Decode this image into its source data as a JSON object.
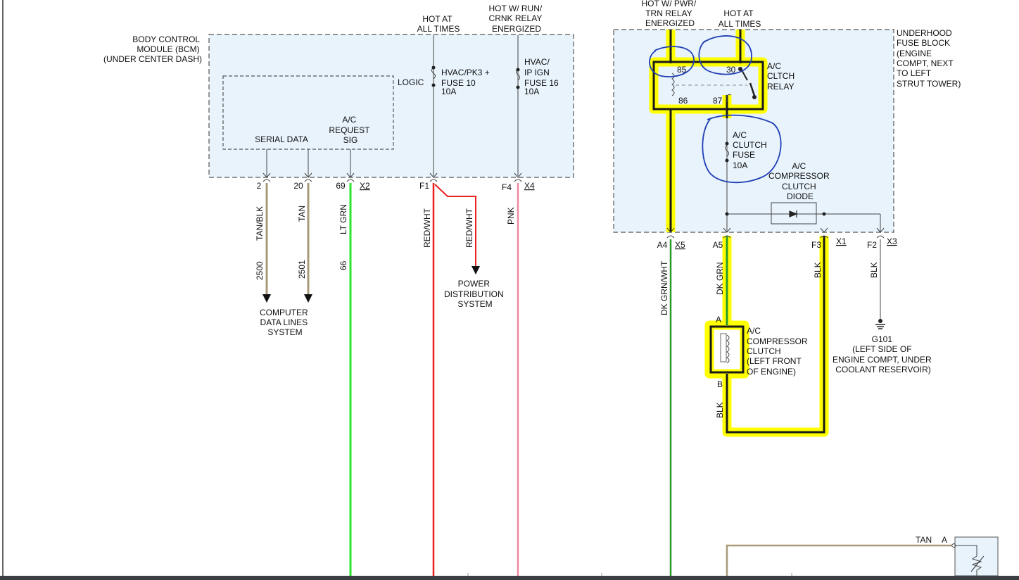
{
  "labels": {
    "bcm_title": [
      "BODY CONTROL",
      "MODULE (BCM)",
      "(UNDER CENTER DASH)"
    ],
    "logic": "LOGIC",
    "serial_data": "SERIAL DATA",
    "ac_request": [
      "A/C",
      "REQUEST",
      "SIG"
    ],
    "hot_all_times_1": [
      "HOT AT",
      "ALL TIMES"
    ],
    "hot_run_crnk": [
      "HOT W/ RUN/",
      "CRNK RELAY",
      "ENERGIZED"
    ],
    "fuse10": [
      "HVAC/PK3 +",
      "FUSE 10",
      "10A"
    ],
    "fuse16": [
      "HVAC/",
      "IP IGN",
      "FUSE 16",
      "10A"
    ],
    "hot_pwr_trn": [
      "HOT W/ PWR/",
      "TRN RELAY",
      "ENERGIZED"
    ],
    "hot_all_times_2": [
      "HOT AT",
      "ALL TIMES"
    ],
    "underhood": [
      "UNDERHOOD",
      "FUSE BLOCK",
      "(ENGINE",
      "COMPT, NEXT",
      "TO LEFT",
      "STRUT TOWER)"
    ],
    "relay": [
      "A/C",
      "CLTCH",
      "RELAY"
    ],
    "clutch_fuse": [
      "A/C",
      "CLUTCH",
      "FUSE",
      "10A"
    ],
    "diode": [
      "A/C",
      "COMPRESSOR",
      "CLUTCH",
      "DIODE"
    ],
    "compressor": [
      "A/C",
      "COMPRESSOR",
      "CLUTCH",
      "(LEFT FRONT",
      "OF ENGINE)"
    ],
    "g101": [
      "G101",
      "(LEFT SIDE OF",
      "ENGINE COMPT, UNDER",
      "COOLANT RESERVOIR)"
    ],
    "computer_data": [
      "COMPUTER",
      "DATA LINES",
      "SYSTEM"
    ],
    "power_dist": [
      "POWER",
      "DISTRIBUTION",
      "SYSTEM"
    ]
  },
  "relay_pins": {
    "p85": "85",
    "p86": "86",
    "p30": "30",
    "p87": "87"
  },
  "pins": {
    "bcm": [
      "2",
      "20",
      "69",
      "F1",
      "F4"
    ],
    "bcm_conn": [
      "X2",
      "X4"
    ],
    "ufb": [
      "A4",
      "A5",
      "F3",
      "F2"
    ],
    "ufb_conn": [
      "X5",
      "X1",
      "X3"
    ],
    "comp_a": "A",
    "comp_b": "B",
    "tan_pin": "A"
  },
  "wires": {
    "tan_blk": "TAN/BLK",
    "tan": "TAN",
    "lt_grn": "LT GRN",
    "red_wht": "RED/WHT",
    "pnk": "PNK",
    "dk_grn_wht": "DK GRN/WHT",
    "dk_grn": "DK GRN",
    "blk": "BLK",
    "tan_bottom": "TAN"
  },
  "circuits": [
    "2500",
    "2501",
    "66"
  ],
  "colors": {
    "tan": "#a89a78",
    "lt_grn": "#2ee62e",
    "red": "#e82020",
    "pnk": "#f08aa0",
    "dk_grn": "#2a9a2a",
    "highlight": "#ffff00",
    "annotation": "#1f3fb5"
  }
}
